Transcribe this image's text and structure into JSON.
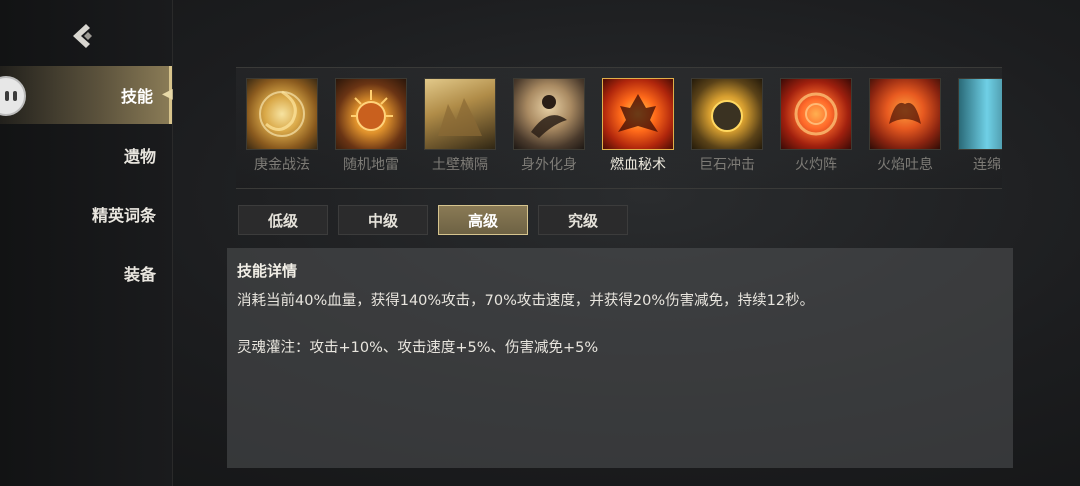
{
  "sidebar": {
    "items": [
      {
        "label": "技能",
        "active": true
      },
      {
        "label": "遗物",
        "active": false
      },
      {
        "label": "精英词条",
        "active": false
      },
      {
        "label": "装备",
        "active": false
      }
    ]
  },
  "skills": [
    {
      "label": "庚金战法",
      "icon": "golden-swirl-icon",
      "colors": [
        "#f2d27a",
        "#8a5a1e"
      ]
    },
    {
      "label": "随机地雷",
      "icon": "spiked-mine-icon",
      "colors": [
        "#e0922c",
        "#4a2410"
      ]
    },
    {
      "label": "土壁横隔",
      "icon": "earth-wall-icon",
      "colors": [
        "#c9a862",
        "#5e4a26"
      ]
    },
    {
      "label": "身外化身",
      "icon": "clone-figure-icon",
      "colors": [
        "#d9b98a",
        "#3e3026"
      ]
    },
    {
      "label": "燃血秘术",
      "icon": "blood-burn-icon",
      "colors": [
        "#ff6a1a",
        "#7a1608"
      ]
    },
    {
      "label": "巨石冲击",
      "icon": "boulder-impact-icon",
      "colors": [
        "#f0c040",
        "#4a3a18"
      ]
    },
    {
      "label": "火灼阵",
      "icon": "fire-circle-icon",
      "colors": [
        "#ff8a2a",
        "#8a1a10"
      ]
    },
    {
      "label": "火焰吐息",
      "icon": "fire-breath-icon",
      "colors": [
        "#ff7a30",
        "#7a2410"
      ]
    },
    {
      "label": "连绵之",
      "icon": "water-curtain-icon",
      "colors": [
        "#6fd0e6",
        "#16404a"
      ]
    }
  ],
  "selected_skill": "燃血秘术",
  "tiers": [
    {
      "label": "低级",
      "active": false
    },
    {
      "label": "中级",
      "active": false
    },
    {
      "label": "高级",
      "active": true
    },
    {
      "label": "究级",
      "active": false
    }
  ],
  "detail": {
    "title": "技能详情",
    "description": "消耗当前40%血量，获得140%攻击，70%攻击速度，并获得20%伤害减免，持续12秒。",
    "soul_infusion": "灵魂灌注：攻击+10%、攻击速度+5%、伤害减免+5%"
  }
}
